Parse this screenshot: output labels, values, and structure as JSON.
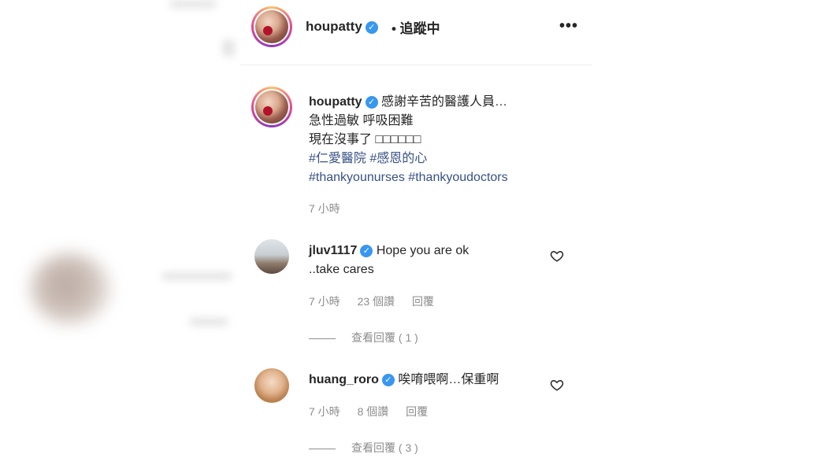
{
  "post": {
    "author": "houpatty",
    "follow_status": "• 追蹤中",
    "more_icon": "more-horizontal-icon"
  },
  "caption": {
    "username": "houpatty",
    "lines": [
      "感謝辛苦的醫護人員…",
      "急性過敏 呼吸困難",
      "現在沒事了 □□□□□□"
    ],
    "hashtags_line1": "#仁愛醫院 #感恩的心",
    "hashtags_line2": "#thankyounurses #thankyoudoctors",
    "time": "7 小時"
  },
  "comments": [
    {
      "username": "jluv1117",
      "text_line1": "Hope you are ok",
      "text_line2": "..take cares",
      "time": "7 小時",
      "likes": "23 個讚",
      "reply": "回覆",
      "view_replies": "查看回覆 ( 1 )"
    },
    {
      "username": "huang_roro",
      "text_line1": "唉唷喂啊…保重啊",
      "time": "7 小時",
      "likes": "8 個讚",
      "reply": "回覆",
      "view_replies": "查看回覆 ( 3 )"
    }
  ],
  "colors": {
    "verified": "#3897f0",
    "hashtag": "#385185",
    "muted": "#8e8e8e"
  }
}
